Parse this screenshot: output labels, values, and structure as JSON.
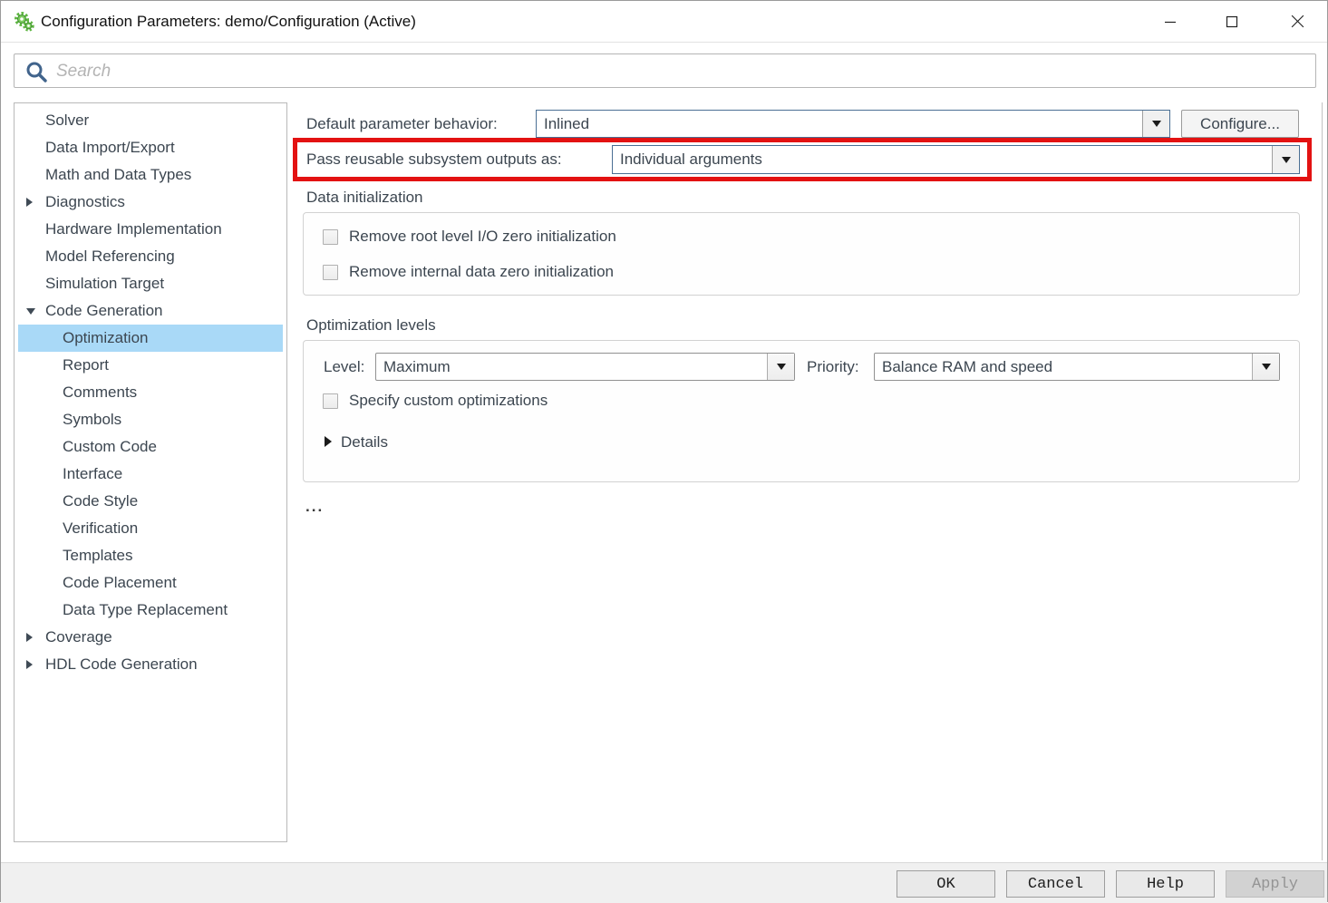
{
  "window": {
    "title": "Configuration Parameters: demo/Configuration (Active)"
  },
  "search": {
    "placeholder": "Search"
  },
  "sidebar": {
    "items": [
      {
        "label": "Solver",
        "level": 1,
        "arrow": "none",
        "selected": false
      },
      {
        "label": "Data Import/Export",
        "level": 1,
        "arrow": "none",
        "selected": false
      },
      {
        "label": "Math and Data Types",
        "level": 1,
        "arrow": "none",
        "selected": false
      },
      {
        "label": "Diagnostics",
        "level": 1,
        "arrow": "collapsed",
        "selected": false
      },
      {
        "label": "Hardware Implementation",
        "level": 1,
        "arrow": "none",
        "selected": false
      },
      {
        "label": "Model Referencing",
        "level": 1,
        "arrow": "none",
        "selected": false
      },
      {
        "label": "Simulation Target",
        "level": 1,
        "arrow": "none",
        "selected": false
      },
      {
        "label": "Code Generation",
        "level": 1,
        "arrow": "expanded",
        "selected": false
      },
      {
        "label": "Optimization",
        "level": 2,
        "arrow": "none",
        "selected": true
      },
      {
        "label": "Report",
        "level": 2,
        "arrow": "none",
        "selected": false
      },
      {
        "label": "Comments",
        "level": 2,
        "arrow": "none",
        "selected": false
      },
      {
        "label": "Symbols",
        "level": 2,
        "arrow": "none",
        "selected": false
      },
      {
        "label": "Custom Code",
        "level": 2,
        "arrow": "none",
        "selected": false
      },
      {
        "label": "Interface",
        "level": 2,
        "arrow": "none",
        "selected": false
      },
      {
        "label": "Code Style",
        "level": 2,
        "arrow": "none",
        "selected": false
      },
      {
        "label": "Verification",
        "level": 2,
        "arrow": "none",
        "selected": false
      },
      {
        "label": "Templates",
        "level": 2,
        "arrow": "none",
        "selected": false
      },
      {
        "label": "Code Placement",
        "level": 2,
        "arrow": "none",
        "selected": false
      },
      {
        "label": "Data Type Replacement",
        "level": 2,
        "arrow": "none",
        "selected": false
      },
      {
        "label": "Coverage",
        "level": 1,
        "arrow": "collapsed",
        "selected": false
      },
      {
        "label": "HDL Code Generation",
        "level": 1,
        "arrow": "collapsed",
        "selected": false
      }
    ]
  },
  "main": {
    "default_param": {
      "label": "Default parameter behavior:",
      "value": "Inlined",
      "configure_label": "Configure..."
    },
    "pass_reusable": {
      "label": "Pass reusable subsystem outputs as:",
      "value": "Individual arguments",
      "highlighted": true
    },
    "data_init": {
      "title": "Data initialization",
      "checkboxes": [
        {
          "label": "Remove root level I/O zero initialization",
          "checked": false
        },
        {
          "label": "Remove internal data zero initialization",
          "checked": false
        }
      ]
    },
    "opt_levels": {
      "title": "Optimization levels",
      "level_label": "Level:",
      "level_value": "Maximum",
      "priority_label": "Priority:",
      "priority_value": "Balance RAM and speed",
      "custom_checkbox": {
        "label": "Specify custom optimizations",
        "checked": false
      },
      "details_label": "Details"
    },
    "ellipsis": "..."
  },
  "footer": {
    "buttons": [
      {
        "label": "OK",
        "enabled": true
      },
      {
        "label": "Cancel",
        "enabled": true
      },
      {
        "label": "Help",
        "enabled": true
      },
      {
        "label": "Apply",
        "enabled": false
      }
    ]
  },
  "colors": {
    "highlight_red": "#e31212",
    "selection_blue": "#a9d9f7",
    "dropdown_border_blue": "#4a6f94",
    "text": "#3c4650",
    "app_icon_green": "#5db540"
  }
}
